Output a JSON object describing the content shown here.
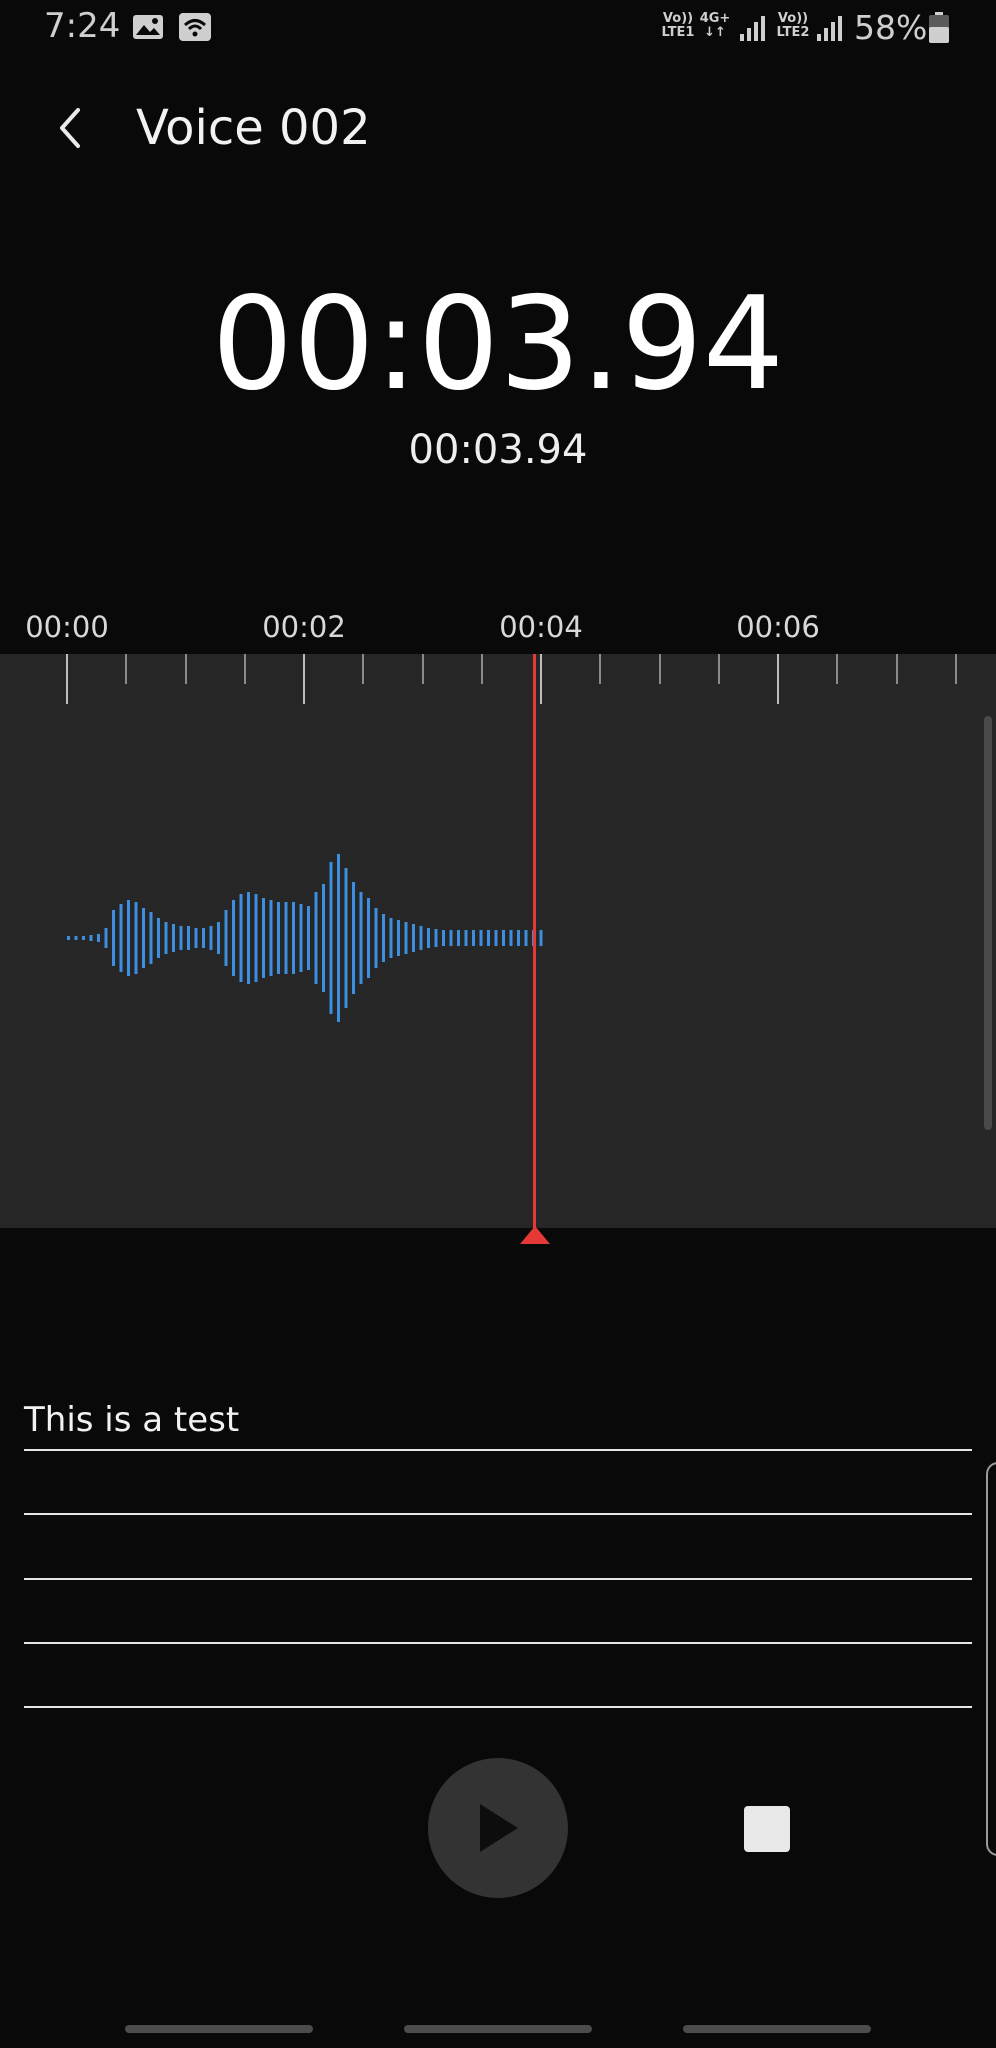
{
  "status_bar": {
    "time": "7:24",
    "sim1_volte_top": "Vo))",
    "sim1_volte_bottom": "LTE1",
    "network_type": "4G+",
    "sim2_volte_top": "Vo))",
    "sim2_volte_bottom": "LTE2",
    "battery_percent": "58%"
  },
  "header": {
    "title": "Voice 002"
  },
  "timer": {
    "elapsed": "00:03.94",
    "total": "00:03.94"
  },
  "timeline": {
    "tick_labels": [
      "00:00",
      "00:02",
      "00:04",
      "00:06"
    ]
  },
  "memo": {
    "text": "This is a test"
  },
  "colors": {
    "background": "#090909",
    "panel": "#262626",
    "waveform": "#3b8ee0",
    "playhead": "#e53935"
  },
  "icons": {
    "back": "chevron-left-icon",
    "play": "play-icon",
    "stop": "stop-icon"
  }
}
